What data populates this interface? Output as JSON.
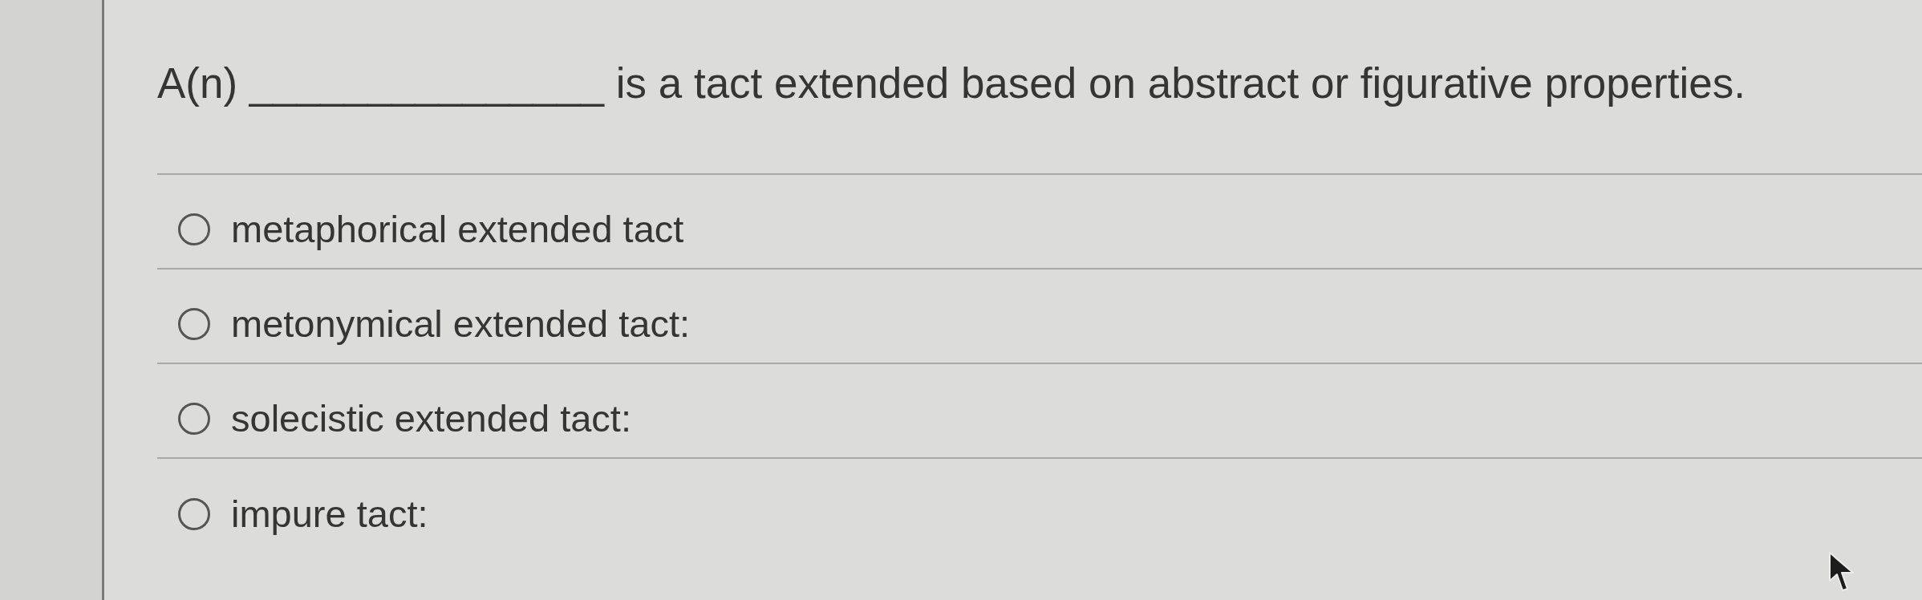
{
  "question": {
    "text": "A(n) _______________ is a tact extended based on abstract or figurative properties."
  },
  "options": [
    {
      "label": "metaphorical extended tact",
      "selected": false
    },
    {
      "label": "metonymical extended tact:",
      "selected": false
    },
    {
      "label": "solecistic extended tact:",
      "selected": false
    },
    {
      "label": "impure tact:",
      "selected": false
    }
  ]
}
